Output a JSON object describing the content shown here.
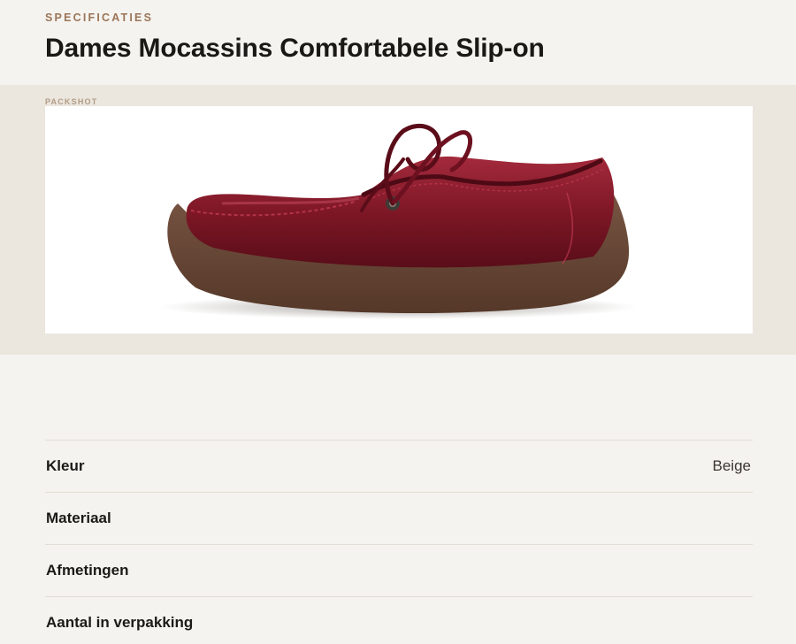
{
  "header": {
    "eyebrow": "SPECIFICATIES",
    "title": "Dames Mocassins Comfortabele Slip-on"
  },
  "packshot": {
    "label": "PACKSHOT",
    "image_subject": "burgundy leather lace-up moccasin shoe with brown crepe sole",
    "colors": {
      "leather": "#7e1726",
      "leather_dark": "#5a0d19",
      "sole": "#6b4a3a"
    }
  },
  "specs": [
    {
      "label": "Kleur",
      "value": "Beige"
    },
    {
      "label": "Materiaal",
      "value": ""
    },
    {
      "label": "Afmetingen",
      "value": ""
    },
    {
      "label": "Aantal in verpakking",
      "value": ""
    }
  ]
}
